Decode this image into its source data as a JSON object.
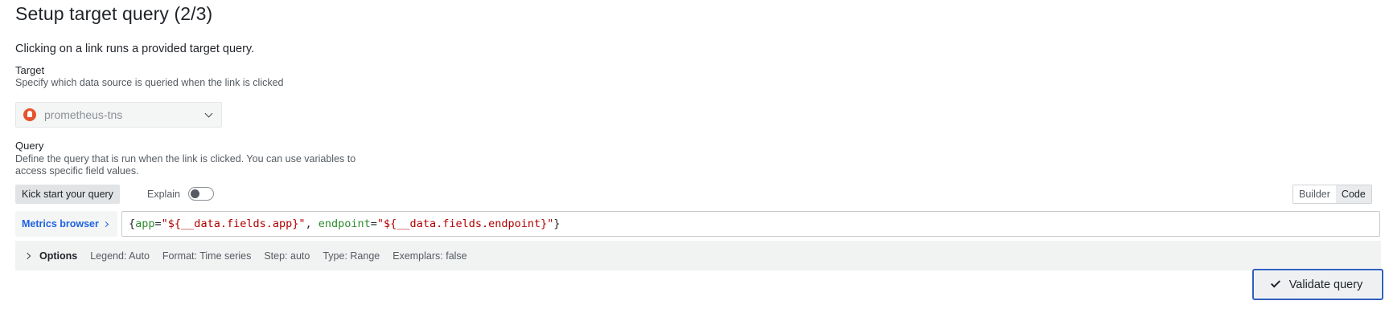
{
  "page": {
    "title": "Setup target query (2/3)",
    "subtitle": "Clicking on a link runs a provided target query."
  },
  "target": {
    "label": "Target",
    "description": "Specify which data source is queried when the link is clicked",
    "datasource": "prometheus-tns",
    "datasource_icon": "prometheus-icon"
  },
  "query": {
    "label": "Query",
    "description_line1": "Define the query that is run when the link is clicked. You can use variables to",
    "description_line2": "access specific field values.",
    "kick_start_label": "Kick start your query",
    "explain_label": "Explain",
    "explain_enabled": false,
    "mode_builder": "Builder",
    "mode_code": "Code",
    "active_mode": "Code",
    "metrics_browser_label": "Metrics browser",
    "expression": {
      "open_brace": "{",
      "label1": "app",
      "eq1": "=",
      "value1": "\"${__data.fields.app}\"",
      "sep": ", ",
      "label2": "endpoint",
      "eq2": "=",
      "value2": "\"${__data.fields.endpoint}\"",
      "close_brace": "}"
    }
  },
  "options": {
    "title": "Options",
    "legend": "Legend: Auto",
    "format": "Format: Time series",
    "step": "Step: auto",
    "type": "Type: Range",
    "exemplars": "Exemplars: false"
  },
  "actions": {
    "validate_label": "Validate query"
  },
  "colors": {
    "accent": "#1f62e0",
    "focus_border": "#2f5fbd",
    "prometheus": "#e6522c",
    "label_token": "#2e8b2e",
    "string_token": "#b00000"
  }
}
